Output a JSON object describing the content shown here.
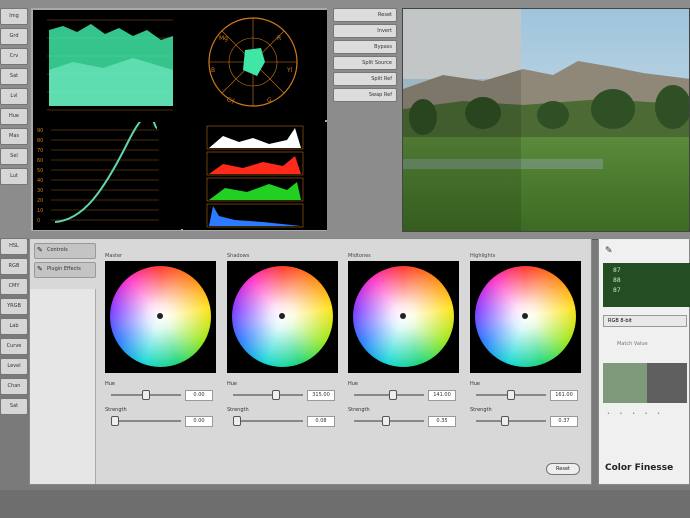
{
  "left_tabs": [
    "Img",
    "Grd",
    "Crv",
    "Sat",
    "Lvl",
    "Hue",
    "Mas",
    "Sel",
    "Lut"
  ],
  "scope_buttons": [
    "Reset",
    "Invert",
    "Bypass",
    "Split Source",
    "Split Ref",
    "Swap Ref"
  ],
  "scope_labels": {
    "curve_ticks": [
      "90",
      "80",
      "70",
      "60",
      "50",
      "40",
      "30",
      "20",
      "10",
      "0"
    ]
  },
  "panel_tabs": [
    {
      "label": "Controls",
      "icon": "pencil-icon"
    },
    {
      "label": "Plugin Effects",
      "icon": "pencil-icon"
    }
  ],
  "bottom_left_tabs": [
    "HSL",
    "RGB",
    "CMY",
    "YRGB",
    "Lab",
    "Curve",
    "Level",
    "Chan",
    "Sat"
  ],
  "wheels": [
    {
      "name": "Master",
      "hue_label": "Hue",
      "hue_value": "0.00",
      "strength_label": "Strength",
      "strength_value": "0.00",
      "hue_frac": 0.5,
      "strength_frac": 0.05
    },
    {
      "name": "Shadows",
      "hue_label": "Hue",
      "hue_value": "315.00",
      "strength_label": "Strength",
      "strength_value": "0.08",
      "hue_frac": 0.62,
      "strength_frac": 0.05
    },
    {
      "name": "Midtones",
      "hue_label": "Hue",
      "hue_value": "141.00",
      "strength_label": "Strength",
      "strength_value": "0.35",
      "hue_frac": 0.55,
      "strength_frac": 0.45
    },
    {
      "name": "Highlights",
      "hue_label": "Hue",
      "hue_value": "161.00",
      "strength_label": "Strength",
      "strength_value": "0.37",
      "hue_frac": 0.5,
      "strength_frac": 0.42
    }
  ],
  "reset_label": "Reset",
  "right_panel": {
    "green_values": [
      "87",
      "88",
      "87"
    ],
    "mode_label": "RGB 8-bit",
    "match_label": "Match Value",
    "logo": "Color Finesse"
  },
  "colors": {
    "scope_green": "#3fe6a6",
    "scope_orange": "#d27a1a",
    "accent_green": "#234d23"
  }
}
